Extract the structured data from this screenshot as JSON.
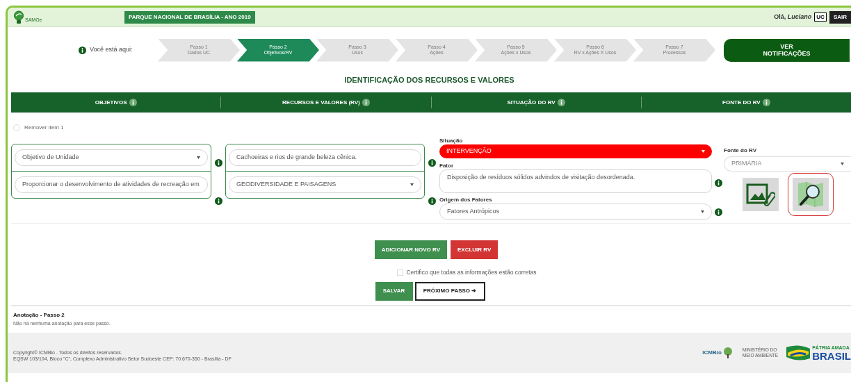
{
  "header": {
    "logo_text": "SAMGe",
    "park_title": "PARQUE NACIONAL DE BRASÍLIA - ANO 2019",
    "greeting": "Olá, *Luciano*",
    "profile_badge": "UC",
    "logout_button": "SAIR"
  },
  "stepper": {
    "you_are_here": "Você está aqui:",
    "steps": [
      {
        "title": "Passo 1",
        "subtitle": "Dados UC",
        "selected": false
      },
      {
        "title": "Passo 2",
        "subtitle": "Objetivos/RV",
        "selected": true
      },
      {
        "title": "Passo 3",
        "subtitle": "Usos",
        "selected": false
      },
      {
        "title": "Passo 4",
        "subtitle": "Ações",
        "selected": false
      },
      {
        "title": "Passo 5",
        "subtitle": "Ações x Usos",
        "selected": false
      },
      {
        "title": "Passo 6",
        "subtitle": "RV x Ações X Usos",
        "selected": false
      },
      {
        "title": "Passo 7",
        "subtitle": "Processos",
        "selected": false
      }
    ],
    "notifications_button": "VER NOTIFICAÇÕES"
  },
  "section_title": "IDENTIFICAÇÃO DOS RECURSOS E VALORES",
  "columns": [
    "OBJETIVOS",
    "RECURSOS E VALORES (RV)",
    "SITUAÇÃO DO RV",
    "FONTE DO RV"
  ],
  "item": {
    "remove_label": "Remover item 1",
    "remove_checked": false,
    "objective_type": "Objetivo de Unidade",
    "objective_text": "Proporcionar o desenvolvimento de atividades de recreação em",
    "resource_text": "Cachoeiras e rios de grande beleza cênica.",
    "resource_category": "GEODIVERSIDADE E PAISAGENS",
    "situation_label": "Situação",
    "situation_value": "INTERVENÇÃO",
    "factor_label": "Fator",
    "factor_value": "Disposição de resíduos sólidos advindos de visitação desordenada.",
    "origin_label": "Origem dos Fatores",
    "origin_value": "Fatores Antrópicos",
    "source_label": "Fonte do RV",
    "source_value": "PRIMÁRIA",
    "tools": [
      {
        "kind": "attach",
        "highlighted": false
      },
      {
        "kind": "map",
        "highlighted": true
      }
    ]
  },
  "actions": {
    "add_button": "ADICIONAR NOVO RV",
    "delete_button": "EXCLUIR RV",
    "certify_label": "Certifico que todas as informações estão corretas",
    "certify_checked": false,
    "save_button": "SALVAR",
    "next_button": "PRÓXIMO PASSO ➜"
  },
  "annotation": {
    "title": "Anotação - Passo 2",
    "text": "Não há nenhuma anotação para esse passo."
  },
  "footer": {
    "copyright": "Copyright© ICMBio . Todos os direitos reservados.",
    "address": "EQSW 103/104, Bloco \"C\", Complexo Administrativo Setor Sudoeste CEP: 70.670-350 - Brasília - DF",
    "icmbio_logo": "ICMBio",
    "ministry_lines": [
      "MINISTÉRIO DO",
      "MEIO AMBIENTE"
    ],
    "brasil_motto": "PÁTRIA AMADA",
    "brasil_name": "BRASIL"
  }
}
